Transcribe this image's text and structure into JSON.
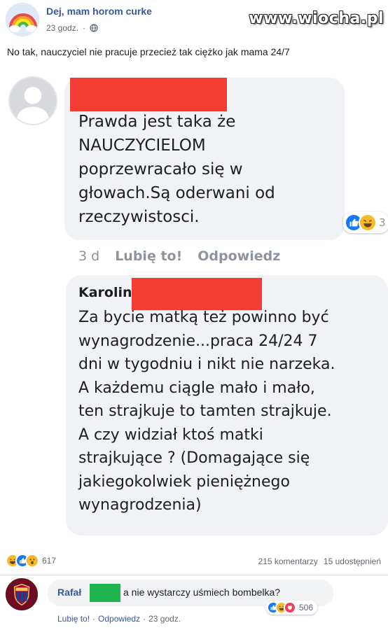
{
  "post": {
    "page_name": "Dej, mam horom curke",
    "time": "23 godz.",
    "privacy_icon": "globe-icon",
    "watermark": "www.wiocha.pl",
    "text": "No tak, nauczyciel nie pracuje przecież tak ciężko jak mama 24/7"
  },
  "screenshot": {
    "comment1": {
      "text": "Prawda jest taka że\nNAUCZYCIELOM\npoprzewracało się w\ngłowach.Są oderwani od\nrzeczywistosci.",
      "reaction_count": "3",
      "time": "3 d",
      "like_label": "Lubię to!",
      "reply_label": "Odpowiedz"
    },
    "comment2": {
      "name_visible": "Karolin",
      "text": "Za bycie matką też powinno być\nwynagrodzenie...praca 24/24 7\ndni w tygodniu i nikt nie narzeka.\nA każdemu ciągle mało i mało,\nten strajkuje to tamten strajkuje.\nA czy widział ktoś matki\nstrajkujące ? (Domagające się\njakiegokolwiek pieniężnego\nwynagrodzenia)"
    },
    "redaction_color": "#f23d34"
  },
  "stats": {
    "reaction_count": "617",
    "comments": "215 komentarzy",
    "shares": "15 udostępnień"
  },
  "reply_comment": {
    "author": "Rafał",
    "text": "a nie wystarczy uśmiech bombelka?",
    "reaction_count": "506",
    "like_label": "Lubię to!",
    "reply_label": "Odpowiedz",
    "time": "23 godz.",
    "redaction_color": "#1fb550"
  },
  "colors": {
    "link_blue": "#385898",
    "like_blue": "#1877f2",
    "haha_yellow": "#f7b928",
    "love_red": "#f33e58"
  }
}
